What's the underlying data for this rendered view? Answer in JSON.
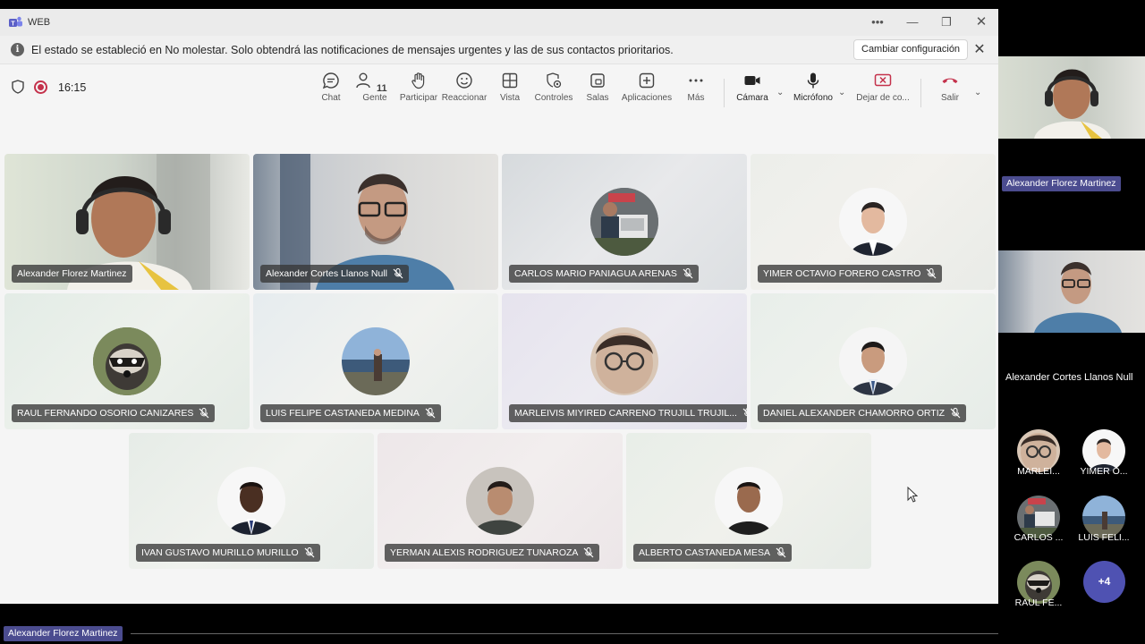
{
  "window": {
    "title": "WEB",
    "banner_message": "El estado se estableció en No molestar. Solo obtendrá las notificaciones de mensajes urgentes y las de sus contactos prioritarios.",
    "banner_button": "Cambiar configuración"
  },
  "toolbar": {
    "timer": "16:15",
    "people_count": "11",
    "buttons": {
      "chat": "Chat",
      "people": "Gente",
      "raise": "Participar",
      "react": "Reaccionar",
      "view": "Vista",
      "controls": "Controles",
      "rooms": "Salas",
      "apps": "Aplicaciones",
      "more": "Más",
      "camera": "Cámara",
      "mic": "Micrófono",
      "share": "Dejar de co...",
      "leave": "Salir"
    },
    "leave_color": "#c4314b"
  },
  "tiles": [
    {
      "name": "Alexander Florez Martinez",
      "muted": false
    },
    {
      "name": "Alexander Cortes Llanos Null",
      "muted": true
    },
    {
      "name": "CARLOS MARIO PANIAGUA ARENAS",
      "muted": true
    },
    {
      "name": "YIMER OCTAVIO FORERO CASTRO",
      "muted": true
    },
    {
      "name": "RAUL FERNANDO OSORIO CANIZARES",
      "muted": true
    },
    {
      "name": "LUIS FELIPE CASTANEDA MEDINA",
      "muted": true
    },
    {
      "name": "MARLEIVIS MIYIRED CARRENO TRUJILL TRUJIL...",
      "muted": true
    },
    {
      "name": "DANIEL ALEXANDER CHAMORRO ORTIZ",
      "muted": true
    },
    {
      "name": "IVAN GUSTAVO MURILLO MURILLO",
      "muted": true
    },
    {
      "name": "YERMAN ALEXIS RODRIGUEZ TUNAROZA",
      "muted": true
    },
    {
      "name": "ALBERTO CASTANEDA MESA",
      "muted": true
    }
  ],
  "rail": {
    "video1_name": "Alexander Florez Martinez",
    "video2_name": "Alexander Cortes Llanos Null",
    "minis": [
      {
        "label": "MARLEI..."
      },
      {
        "label": "YIMER O..."
      },
      {
        "label": "CARLOS ..."
      },
      {
        "label": "LUIS FELI..."
      },
      {
        "label": "RAUL FE..."
      }
    ],
    "more": "+4"
  },
  "bottom_name": "Alexander Florez Martinez"
}
